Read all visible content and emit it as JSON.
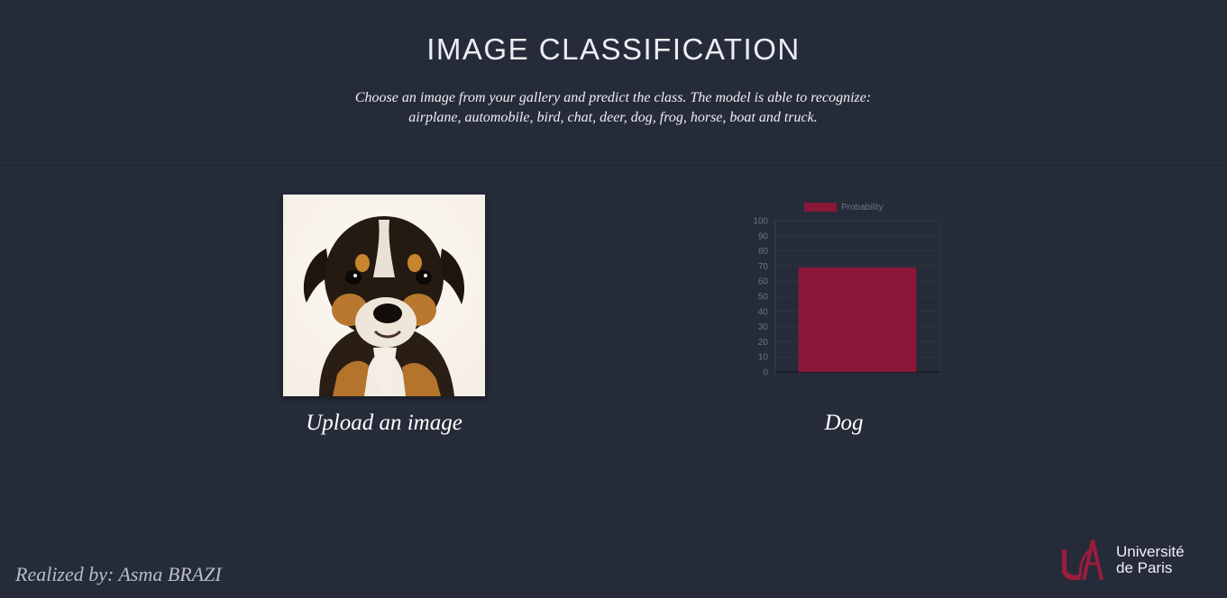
{
  "header": {
    "title": "IMAGE CLASSIFICATION",
    "subtitle_line1": "Choose an image from your gallery and predict the class. The model is able to recognize:",
    "subtitle_line2": "airplane, automobile, bird, chat, deer, dog, frog, horse, boat and truck."
  },
  "upload": {
    "label": "Upload an image"
  },
  "prediction": {
    "label": "Dog"
  },
  "footer": {
    "credit": "Realized by: Asma BRAZI",
    "logo_line1": "Université",
    "logo_line2": "de Paris"
  },
  "colors": {
    "background": "#252b38",
    "bar": "#8a1738",
    "logo": "#9b1c3c"
  },
  "chart_data": {
    "type": "bar",
    "categories": [
      ""
    ],
    "series": [
      {
        "name": "Probability",
        "values": [
          69
        ]
      }
    ],
    "ylim": [
      0,
      100
    ],
    "yticks": [
      "0",
      "10",
      "20",
      "30",
      "40",
      "50",
      "60",
      "70",
      "80",
      "90",
      "100"
    ],
    "legend": "top",
    "grid": true
  }
}
